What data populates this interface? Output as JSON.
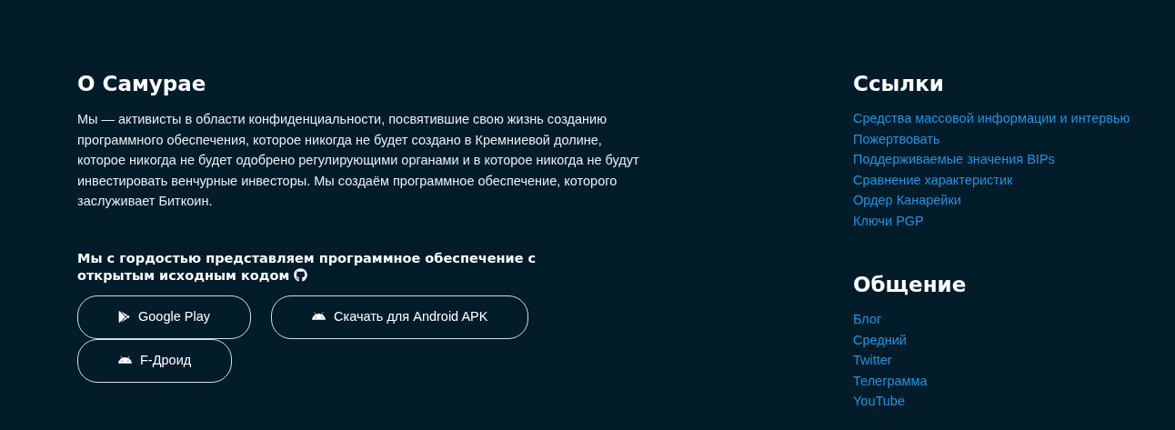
{
  "about": {
    "title": "О Самурае",
    "text": "Мы — активисты в области конфиденциальности, посвятившие свою жизнь созданию программного обеспечения, которое никогда не будет создано в Кремниевой долине, которое никогда не будет одобрено регулирующими органами и в которое никогда не будут инвестировать венчурные инвесторы. Мы создаём программное обеспечение, которого заслуживает Биткоин.",
    "open_source": "Мы с гордостью представляем программное обеспечение с открытым исходным кодом",
    "buttons": [
      {
        "kind": "play",
        "label": "Google Play"
      },
      {
        "kind": "android",
        "label": "Скачать для Android APK"
      },
      {
        "kind": "android",
        "label": "F-Дроид"
      }
    ]
  },
  "link_groups": [
    {
      "title": "Ссылки",
      "links": [
        "Средства массовой информации и интервью",
        "Пожертвовать",
        "Поддерживаемые значения BIPs",
        "Сравнение характеристик",
        "Ордер Канарейки",
        "Ключи PGP"
      ]
    },
    {
      "title": "Общение",
      "links": [
        "Блог",
        "Средний",
        "Twitter",
        "Телеграмма",
        "YouTube"
      ]
    }
  ]
}
